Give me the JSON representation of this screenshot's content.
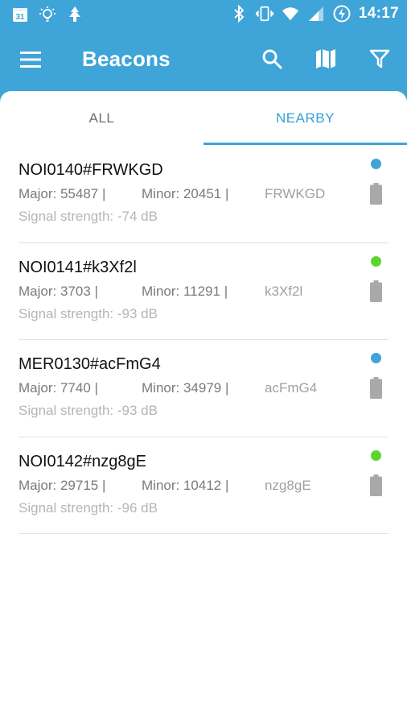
{
  "status_bar": {
    "time": "14:17",
    "calendar_day": "31",
    "icons_left": [
      "calendar-icon",
      "lightbulb-icon",
      "tree-icon"
    ],
    "icons_right": [
      "bluetooth-icon",
      "vibrate-icon",
      "wifi-icon",
      "signal-icon",
      "battery-charging-icon"
    ]
  },
  "app_bar": {
    "title": "Beacons",
    "actions": [
      "search-icon",
      "map-icon",
      "filter-icon"
    ]
  },
  "tabs": [
    {
      "label": "ALL",
      "selected": false
    },
    {
      "label": "NEARBY",
      "selected": true
    }
  ],
  "colors": {
    "primary": "#3fa4d8",
    "tab_selected": "#35a0d6",
    "dot_blue": "#3fa4d8",
    "dot_green": "#5bd62f",
    "battery": "#a9a9a9"
  },
  "beacons": [
    {
      "name": "NOI0140#FRWKGD",
      "major": "Major: 55487 |",
      "minor": "Minor: 20451 |",
      "code": "FRWKGD",
      "signal": "Signal strength: -74 dB",
      "dot_color": "#3fa4d8"
    },
    {
      "name": "NOI0141#k3Xf2l",
      "major": "Major: 3703    |",
      "minor": "Minor: 11291 |",
      "code": "k3Xf2l",
      "signal": "Signal strength: -93 dB",
      "dot_color": "#5bd62f"
    },
    {
      "name": "MER0130#acFmG4",
      "major": "Major: 7740    |",
      "minor": "Minor: 34979 |",
      "code": "acFmG4",
      "signal": "Signal strength: -93 dB",
      "dot_color": "#3fa4d8"
    },
    {
      "name": "NOI0142#nzg8gE",
      "major": "Major: 29715 |",
      "minor": "Minor: 10412 |",
      "code": "nzg8gE",
      "signal": "Signal strength: -96 dB",
      "dot_color": "#5bd62f"
    }
  ]
}
